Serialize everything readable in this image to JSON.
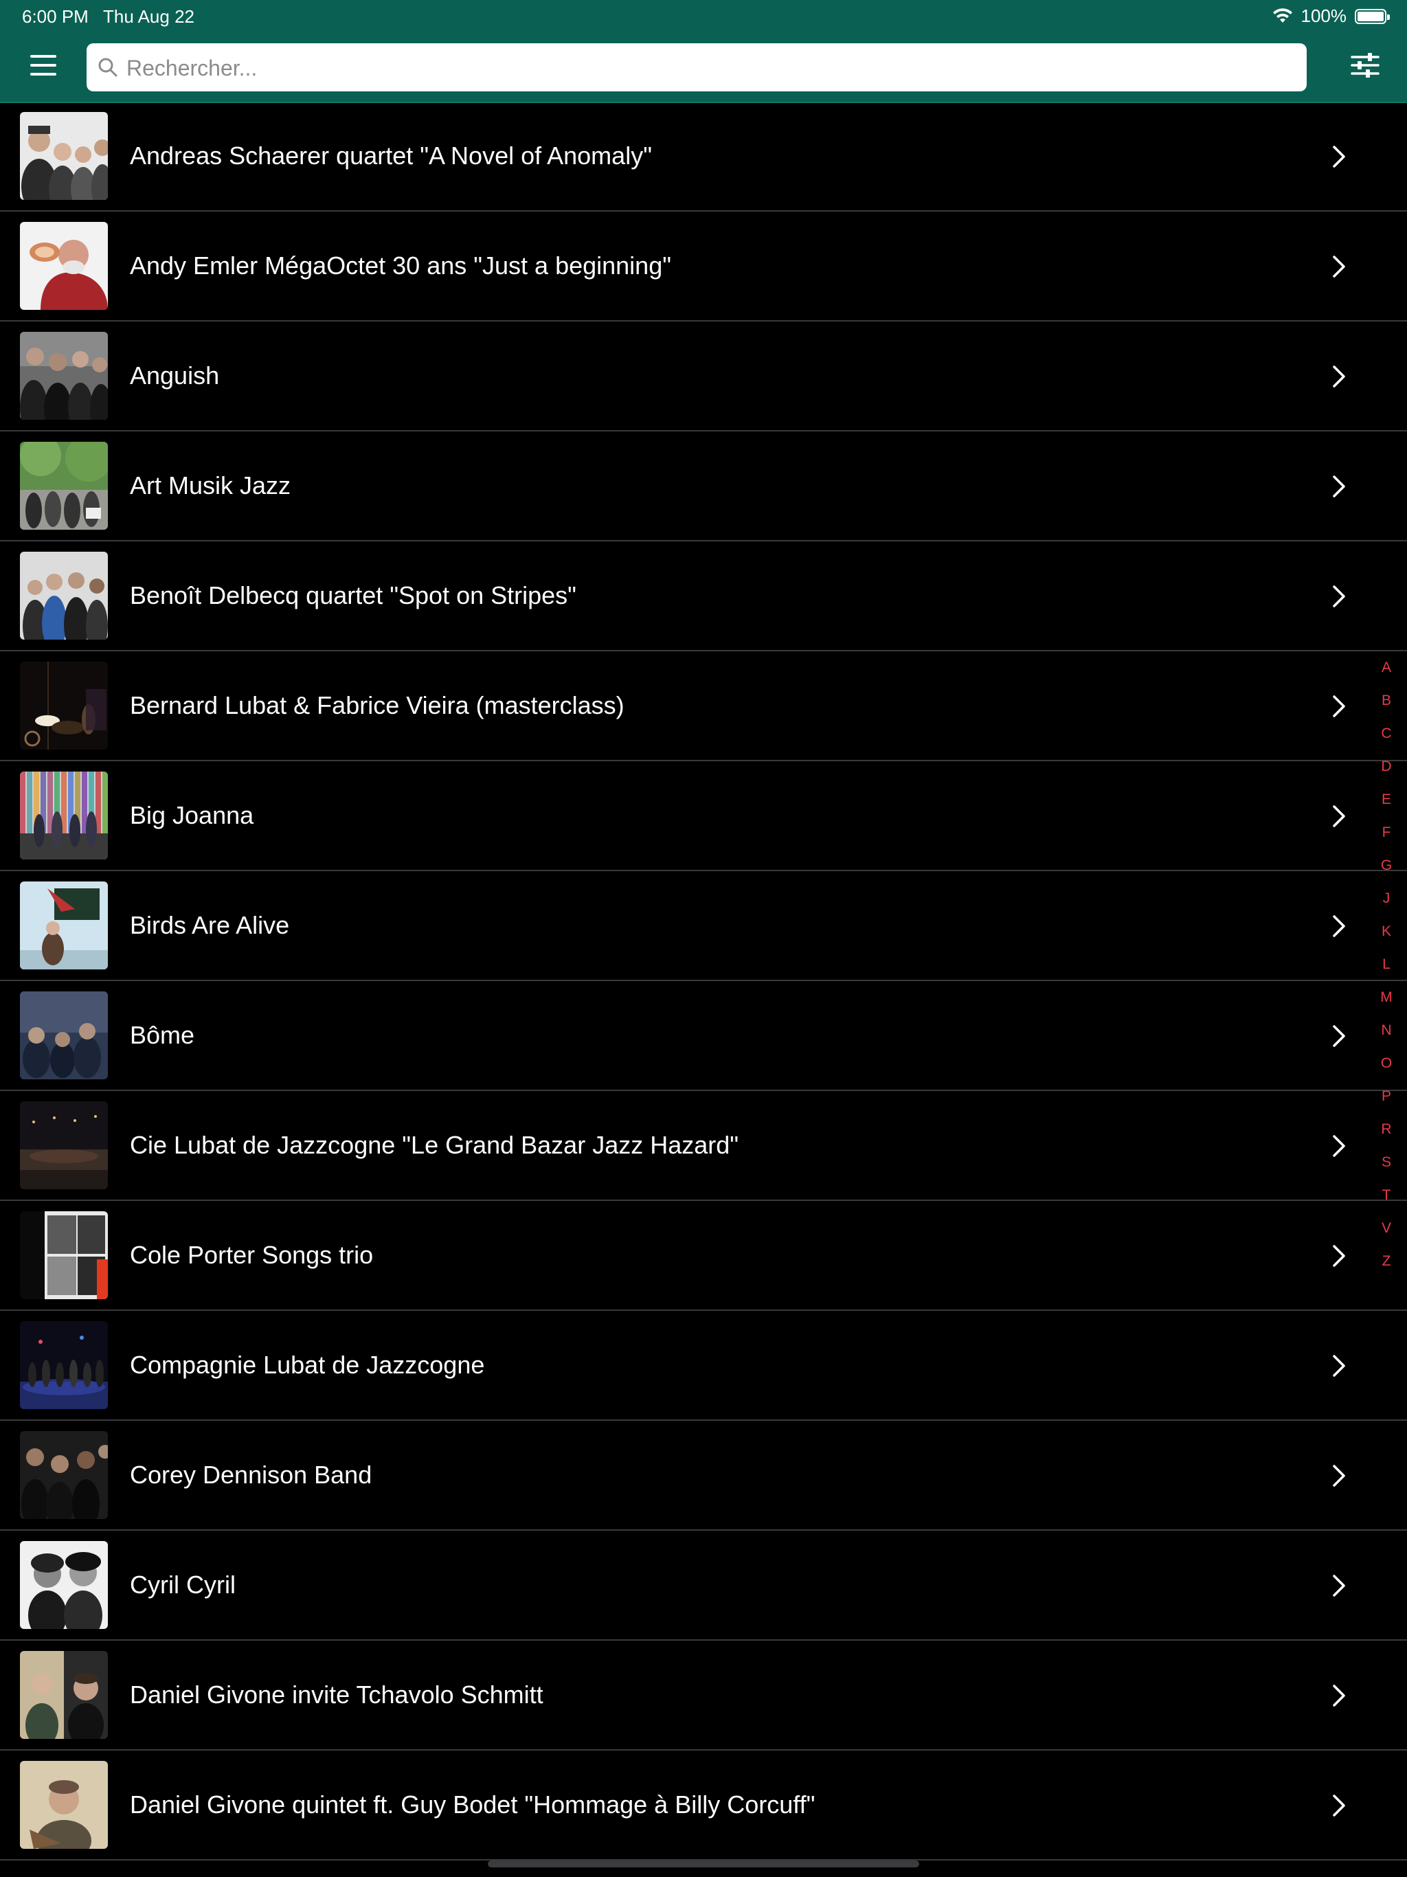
{
  "status_bar": {
    "time": "6:00 PM",
    "date": "Thu Aug 22",
    "battery": "100%"
  },
  "header": {
    "search_placeholder": "Rechercher...",
    "accent_color": "#0a6153",
    "icons": [
      "menu-icon",
      "search-icon",
      "filter-sliders-icon"
    ]
  },
  "list": {
    "items": [
      {
        "title": "Andreas Schaerer quartet \"A Novel of Anomaly\""
      },
      {
        "title": "Andy Emler MégaOctet 30 ans \"Just a beginning\""
      },
      {
        "title": "Anguish"
      },
      {
        "title": "Art Musik Jazz"
      },
      {
        "title": "Benoît Delbecq quartet \"Spot on Stripes\""
      },
      {
        "title": "Bernard Lubat & Fabrice Vieira (masterclass)"
      },
      {
        "title": "Big Joanna"
      },
      {
        "title": "Birds Are Alive"
      },
      {
        "title": "Bôme"
      },
      {
        "title": "Cie Lubat de Jazzcogne \"Le Grand Bazar Jazz Hazard\""
      },
      {
        "title": "Cole Porter Songs trio"
      },
      {
        "title": "Compagnie Lubat de Jazzcogne"
      },
      {
        "title": "Corey Dennison Band"
      },
      {
        "title": "Cyril Cyril"
      },
      {
        "title": "Daniel Givone invite Tchavolo Schmitt"
      },
      {
        "title": "Daniel Givone quintet ft. Guy Bodet \"Hommage à Billy Corcuff\""
      }
    ]
  },
  "section_index": {
    "letters": [
      "A",
      "B",
      "C",
      "D",
      "E",
      "F",
      "G",
      "J",
      "K",
      "L",
      "M",
      "N",
      "O",
      "P",
      "R",
      "S",
      "T",
      "V",
      "Z"
    ],
    "color": "#e8394a"
  }
}
